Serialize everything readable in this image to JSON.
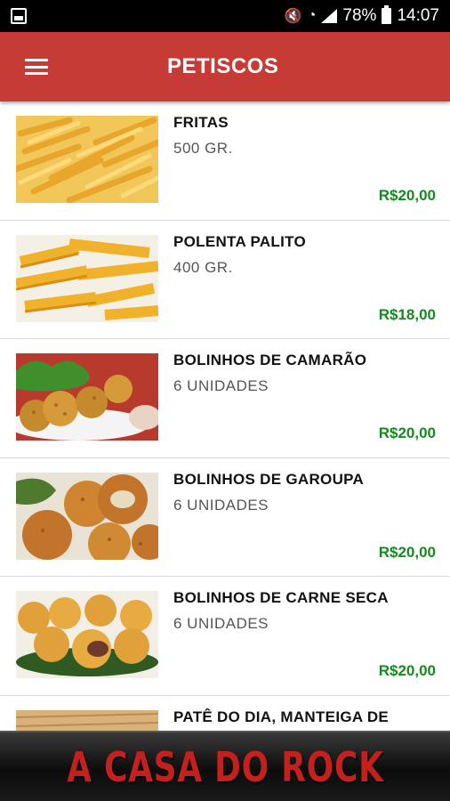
{
  "status_bar": {
    "battery_percent": "78%",
    "time": "14:07",
    "icons": [
      "gallery-icon",
      "mute-icon",
      "wifi-icon",
      "signal-icon",
      "battery-icon"
    ]
  },
  "app_bar": {
    "title": "PETISCOS",
    "menu_icon": "hamburger-menu-icon",
    "color": "#c73b36"
  },
  "items": [
    {
      "name": "FRITAS",
      "desc": "500 GR.",
      "price": "R$20,00",
      "image": "french-fries"
    },
    {
      "name": "POLENTA PALITO",
      "desc": "400 GR.",
      "price": "R$18,00",
      "image": "polenta-sticks"
    },
    {
      "name": "BOLINHOS DE CAMARÃO",
      "desc": "6 UNIDADES",
      "price": "R$20,00",
      "image": "shrimp-croquettes"
    },
    {
      "name": "BOLINHOS DE GAROUPA",
      "desc": "6 UNIDADES",
      "price": "R$20,00",
      "image": "grouper-croquettes"
    },
    {
      "name": "BOLINHOS DE CARNE SECA",
      "desc": "6 UNIDADES",
      "price": "R$20,00",
      "image": "dried-beef-croquettes"
    },
    {
      "name": "PATÊ DO DIA, MANTEIGA DE",
      "desc": "",
      "price": "",
      "image": "bread-pate"
    }
  ],
  "price_color": "#138a1e",
  "banner": {
    "text": "A CASA DO ROCK"
  }
}
